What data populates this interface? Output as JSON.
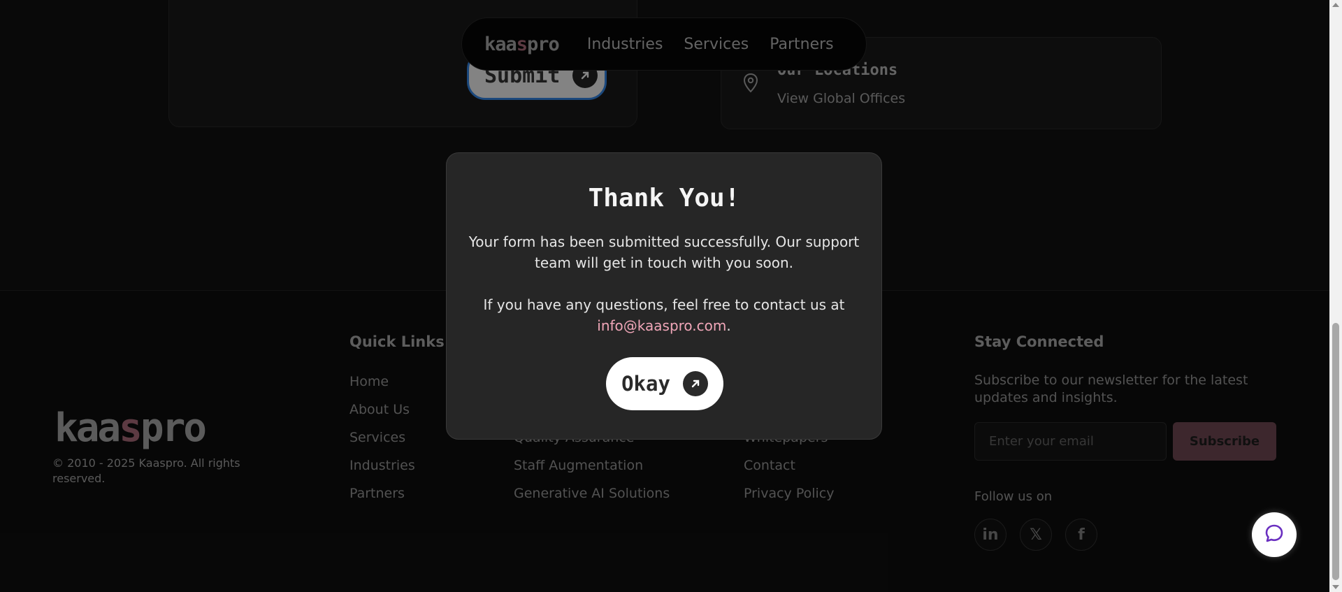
{
  "nav": {
    "logo": {
      "pre": "kaa",
      "accent": "s",
      "post": "pro"
    },
    "items": [
      "Industries",
      "Services",
      "Partners"
    ]
  },
  "form": {
    "submit_label": "Submit"
  },
  "locations": {
    "title": "Our Locations",
    "link": "View Global Offices"
  },
  "footer": {
    "logo": {
      "pre": "kaa",
      "accent": "s",
      "post": "pro"
    },
    "copyright": "© 2010 - 2025 Kaaspro. All rights reserved.",
    "quick_links": {
      "heading": "Quick Links",
      "items": [
        "Home",
        "About Us",
        "Services",
        "Industries",
        "Partners"
      ]
    },
    "services_links": {
      "items": [
        "Quality Assurance",
        "Staff Augmentation",
        "Generative AI Solutions"
      ]
    },
    "resources_links": {
      "items": [
        "Whitepapers",
        "Contact",
        "Privacy Policy"
      ]
    },
    "stay_connected": {
      "heading": "Stay Connected",
      "text": "Subscribe to our newsletter for the latest updates and insights.",
      "email_placeholder": "Enter your email",
      "subscribe_label": "Subscribe",
      "follow_label": "Follow us on",
      "social": [
        {
          "name": "linkedin-icon",
          "glyph": "in"
        },
        {
          "name": "x-icon",
          "glyph": "𝕏"
        },
        {
          "name": "facebook-icon",
          "glyph": "f"
        }
      ]
    }
  },
  "modal": {
    "title": "Thank You!",
    "message": "Your form has been submitted successfully. Our support team will get in touch with you soon.",
    "contact_prefix": "If you have any questions, feel free to contact us at",
    "contact_email": "info@kaaspro.com",
    "contact_suffix": ".",
    "okay_label": "Okay"
  },
  "colors": {
    "accent": "#8e5a66",
    "email_link": "#f0a6b8",
    "subscribe_bg": "#5e3d45",
    "chat_icon": "#6a2fc0"
  },
  "icons": {
    "chat": "chat-bubble-icon",
    "location": "map-pin-icon",
    "arrow": "arrow-up-right-icon"
  }
}
